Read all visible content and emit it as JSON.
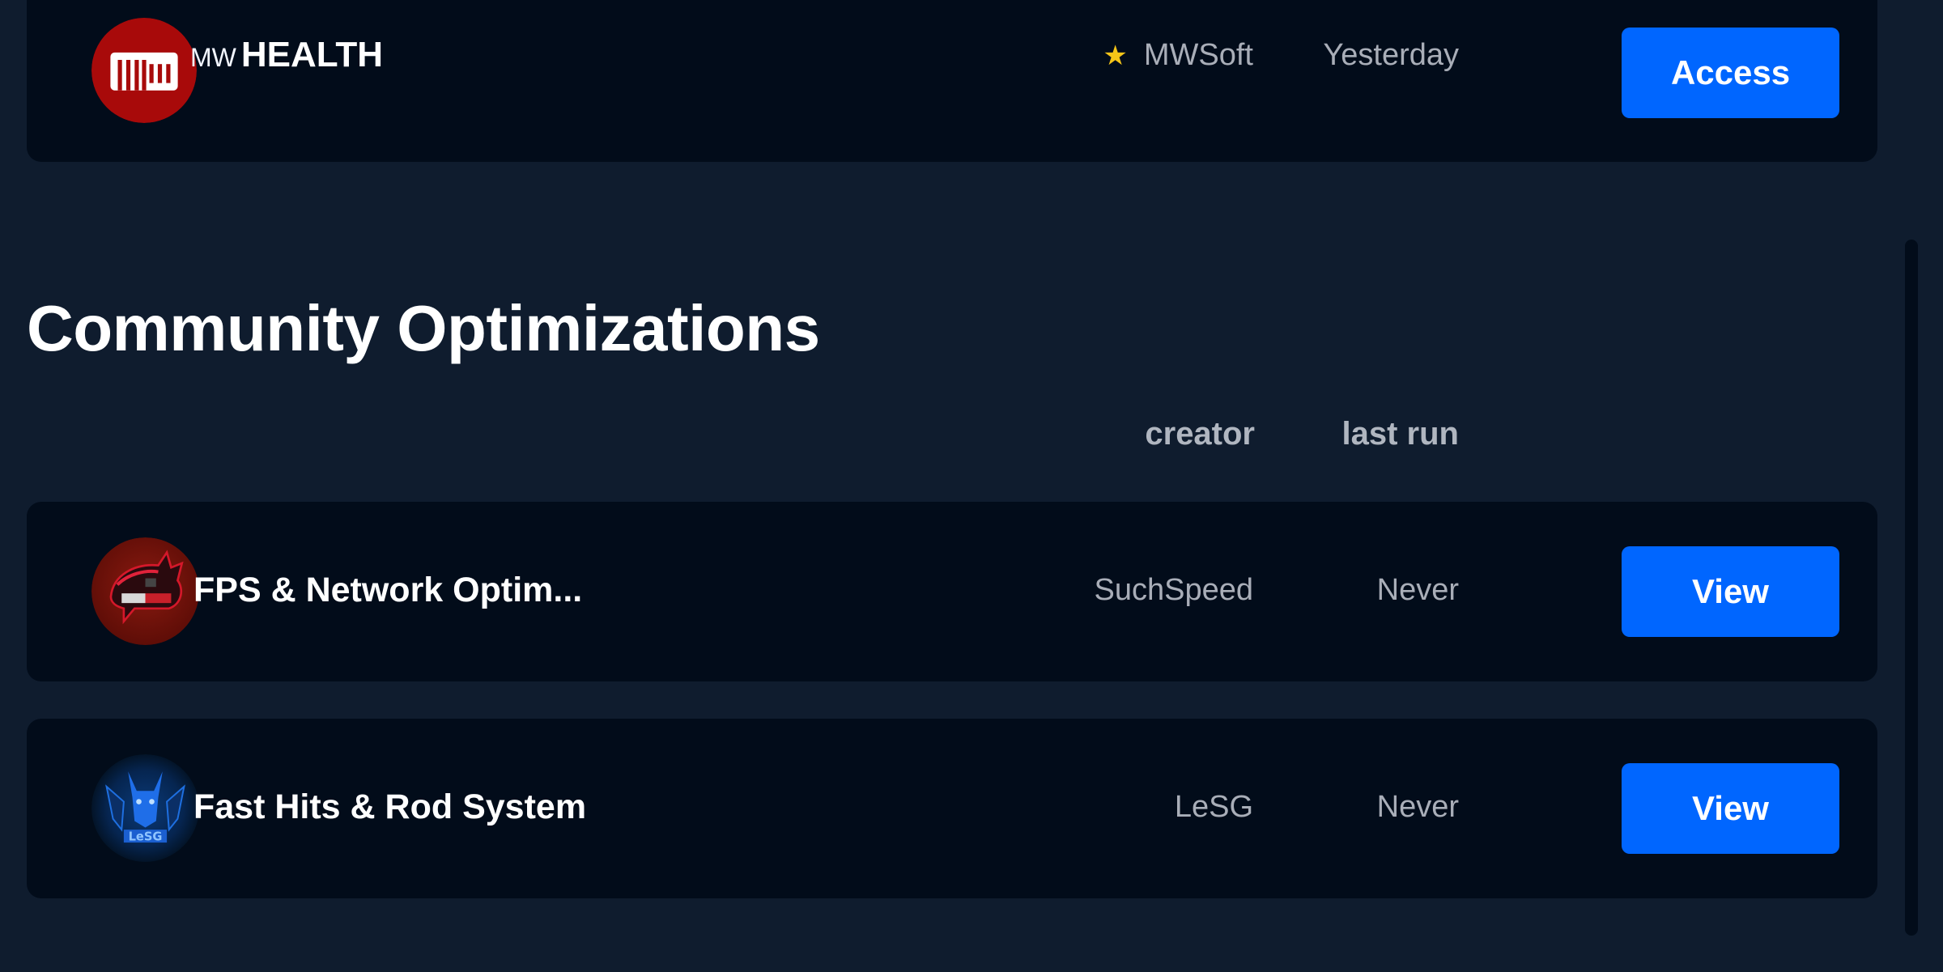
{
  "featured": {
    "brand_small": "MW",
    "brand_big": "HEALTH",
    "logo_icon": "mw-health-logo",
    "creator": "MWSoft",
    "creator_verified_icon": "star-icon",
    "last_run": "Yesterday",
    "action_label": "Access"
  },
  "community": {
    "title": "Community Optimizations",
    "columns": {
      "creator": "creator",
      "last_run": "last run"
    },
    "items": [
      {
        "title": "FPS & Network Optim...",
        "logo_icon": "suchspeed-logo",
        "creator": "SuchSpeed",
        "last_run": "Never",
        "action_label": "View"
      },
      {
        "title": "Fast Hits & Rod System",
        "logo_icon": "lesg-logo",
        "creator": "LeSG",
        "last_run": "Never",
        "action_label": "View"
      }
    ]
  },
  "colors": {
    "page_bg": "#0f1c2e",
    "card_bg": "#020c1a",
    "accent_button": "#0066ff",
    "muted_text": "#a9aeb8",
    "star": "#f5c518",
    "mw_red": "#a80a0a"
  }
}
